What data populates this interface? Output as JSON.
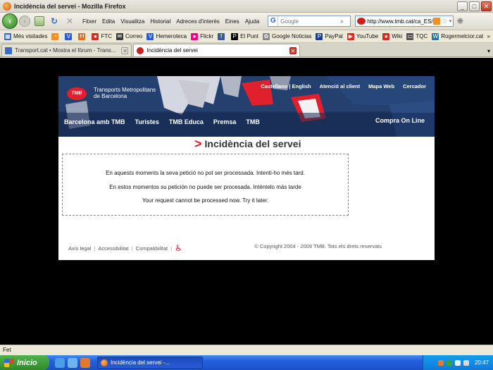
{
  "window": {
    "title": "Incidència del servei - Mozilla Firefox",
    "minimize": "_",
    "maximize": "□",
    "close": "✕"
  },
  "navbar": {
    "back": "‹",
    "forward": "›",
    "reload": "↻",
    "stop": "✕",
    "menu": [
      "Fitxer",
      "Edita",
      "Visualitza",
      "Historial",
      "Adreces d'interès",
      "Eines",
      "Ajuda"
    ],
    "search_engine": "G",
    "search_placeholder": "Google",
    "search_glyph": "⌕",
    "url": "http://www.tmb.cat/ca_ES/ho",
    "star": "☆",
    "drop": "▾",
    "gear": "✺"
  },
  "bookmarks": [
    {
      "label": "Més visitades",
      "color": "#3b6bc7",
      "glyph": "▦"
    },
    {
      "label": "",
      "color": "#f29028",
      "glyph": "◔"
    },
    {
      "label": "",
      "color": "#2a5bd6",
      "glyph": "V"
    },
    {
      "label": "",
      "color": "#e06e1f",
      "glyph": "H"
    },
    {
      "label": "FTC",
      "color": "#d62d20",
      "glyph": "●"
    },
    {
      "label": "Correo",
      "color": "#3a3a3a",
      "glyph": "✉"
    },
    {
      "label": "Hemeroteca",
      "color": "#2a5bd6",
      "glyph": "V"
    },
    {
      "label": "Flickr",
      "color": "#ff0084",
      "glyph": "●"
    },
    {
      "label": "",
      "color": "#3b5998",
      "glyph": "f"
    },
    {
      "label": "El Punt",
      "color": "#000",
      "glyph": "P"
    },
    {
      "label": "Google Noticias",
      "color": "#888",
      "glyph": "✿"
    },
    {
      "label": "PayPal",
      "color": "#1b3f8f",
      "glyph": "P"
    },
    {
      "label": "YouTube",
      "color": "#d62d20",
      "glyph": "▶"
    },
    {
      "label": "Wiki",
      "color": "#d62d20",
      "glyph": "●"
    },
    {
      "label": "TQC",
      "color": "#555",
      "glyph": "▭"
    },
    {
      "label": "Rogermelcior.cat",
      "color": "#21759b",
      "glyph": "W"
    }
  ],
  "bookmarks_more": "»",
  "tabs": [
    {
      "label": "Transport.cat • Mostra el fòrum - Trans...",
      "active": false,
      "close": "✕"
    },
    {
      "label": "Incidència del servei",
      "active": true,
      "close": "✕"
    }
  ],
  "tab_list": "▾",
  "site": {
    "logo": "TMB",
    "org_line1": "Transports Metropolitans",
    "org_line2": "de Barcelona",
    "top_links": [
      "Castellano | English",
      "Atenció al client",
      "Mapa Web",
      "Cercador"
    ],
    "main_nav": [
      "Barcelona amb TMB",
      "Turistes",
      "TMB Educa",
      "Premsa",
      "TMB"
    ],
    "compra": "Compra On Line",
    "heading_chevron": ">",
    "heading": "Incidència del servei",
    "messages": [
      "En aquests moments la seva petició no pot ser processada. Intenti-ho més tard.",
      "En estos momentos su petición no puede ser procesada. Inténtelo más tarde",
      "Your request cannot be processed now. Try it later."
    ],
    "footer_links": [
      "Avís legal",
      "Accessibilitat",
      "Compatibilitat"
    ],
    "footer_sep": "|",
    "access_glyph": "♿",
    "copyright": "© Copyright 2004 - 2009 TMB. Tots els drets reservats"
  },
  "status": "Fet",
  "taskbar": {
    "start": "Inicio",
    "task": "Incidència del servei -...",
    "clock": "20:47"
  },
  "colors": {
    "accent_red": "#e0202c",
    "banner_blue": "#1e3560"
  }
}
